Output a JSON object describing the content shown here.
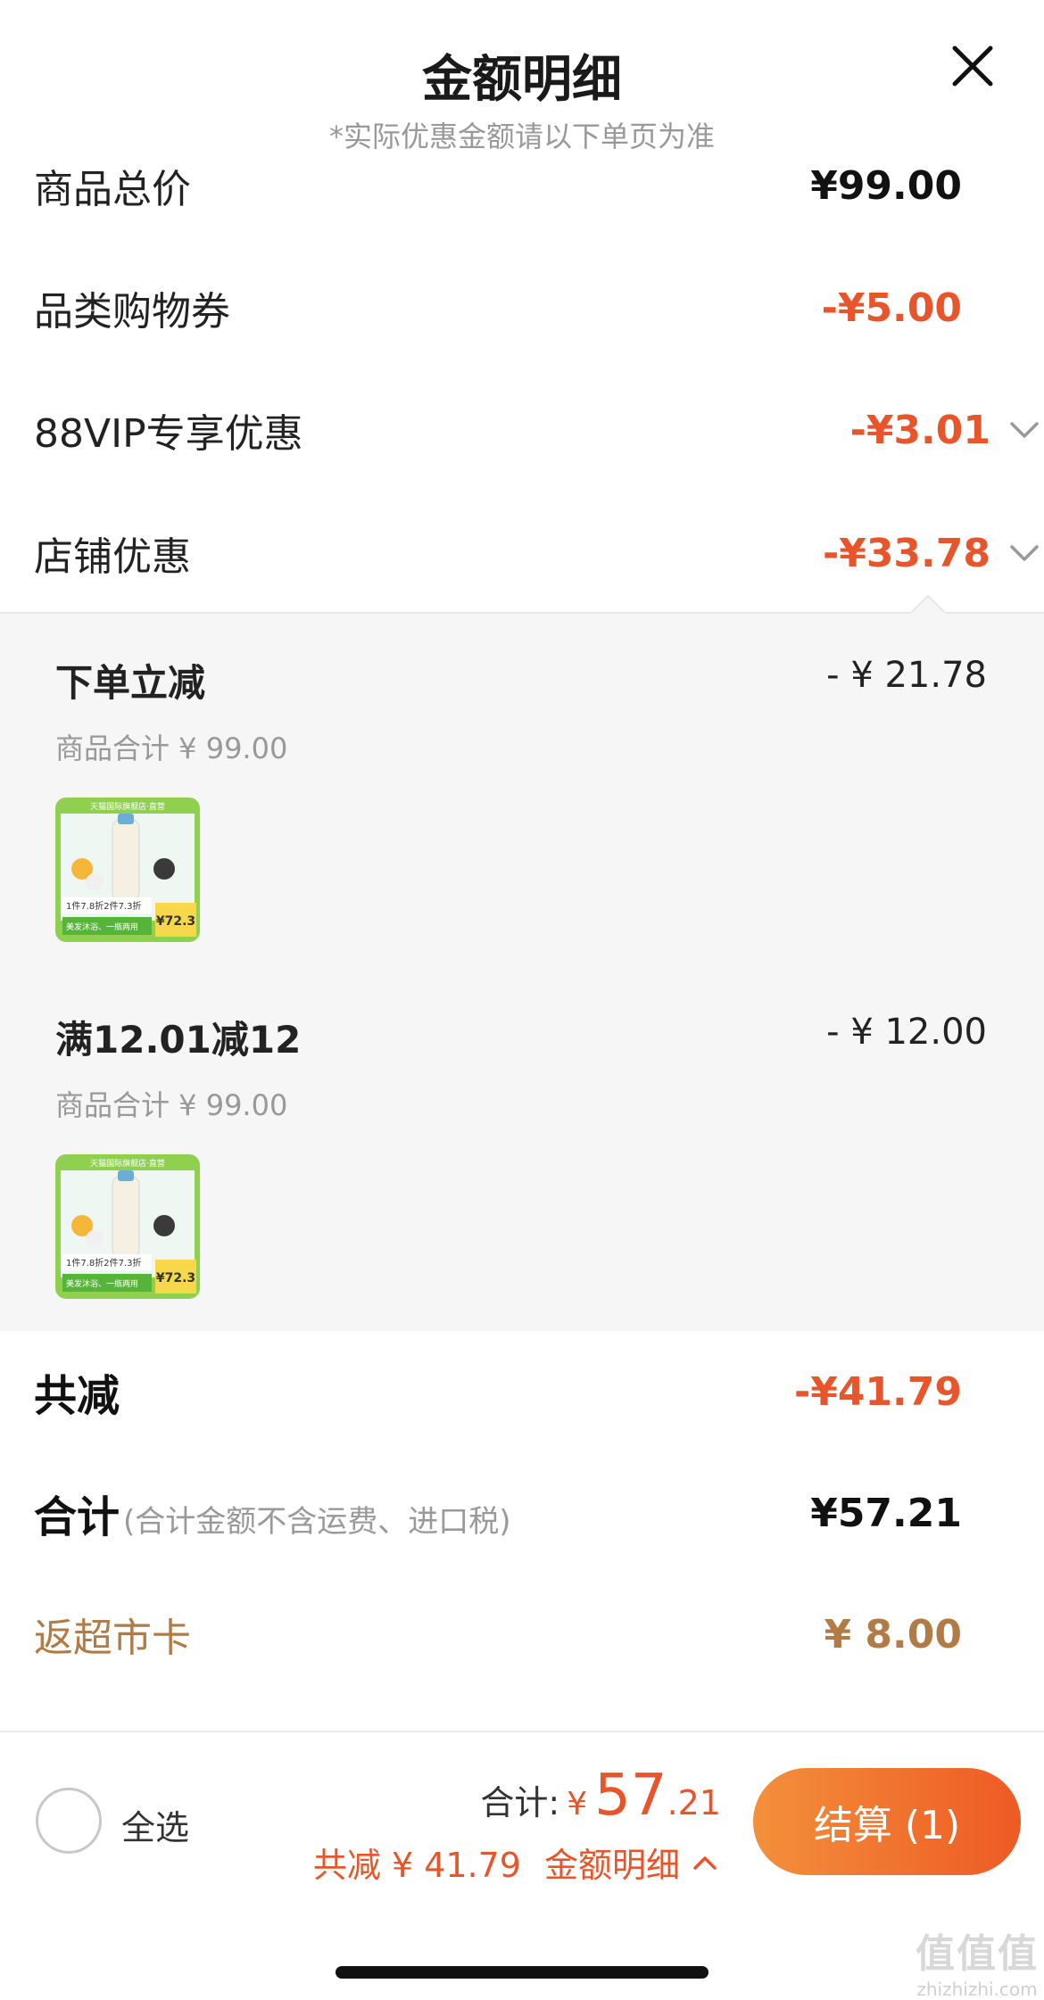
{
  "header": {
    "title": "金额明细",
    "subtitle": "*实际优惠金额请以下单页为准",
    "close_icon": "close-icon"
  },
  "rows": [
    {
      "label": "商品总价",
      "value": "¥99.00",
      "color": "#111111"
    },
    {
      "label": "品类购物券",
      "value": "-¥5.00",
      "color": "#e8552a"
    },
    {
      "label": "88VIP专享优惠",
      "value": "-¥3.01",
      "color": "#e8552a",
      "expandable": true
    },
    {
      "label": "店铺优惠",
      "value": "-¥33.78",
      "color": "#e8552a",
      "expandable": true,
      "expanded": true
    }
  ],
  "store_discounts": [
    {
      "title": "下单立减",
      "amount": "- ¥ 21.78",
      "subtotal": "商品合计 ¥ 99.00",
      "thumb": {
        "top_text": "天猫国际旗舰店·直营",
        "line1": "1件7.8折2件7.3折",
        "line2": "美发沐浴、一瓶两用",
        "price": "¥72.3"
      }
    },
    {
      "title": "满12.01减12",
      "amount": "- ¥ 12.00",
      "subtotal": "商品合计 ¥ 99.00",
      "thumb": {
        "top_text": "天猫国际旗舰店·直营",
        "line1": "1件7.8折2件7.3折",
        "line2": "美发沐浴、一瓶两用",
        "price": "¥72.3"
      }
    }
  ],
  "totals": {
    "discount_label": "共减",
    "discount_value": "-¥41.79",
    "sum_label": "合计",
    "sum_note": "(合计金额不含运费、进口税)",
    "sum_value": "¥57.21",
    "cashback_label": "返超市卡",
    "cashback_value": "¥ 8.00"
  },
  "footer": {
    "select_all": "全选",
    "sum_label": "合计:",
    "yen": "¥",
    "price_int": "57",
    "price_dec": ".21",
    "saving": "共减 ¥ 41.79",
    "detail_link": "金额明细",
    "checkout": "结算 (1)"
  },
  "watermark": {
    "logo": "值值值",
    "text": "zhizhizhi.com"
  },
  "colors": {
    "accent": "#e8552a",
    "gold": "#b07b47",
    "gray": "#999999"
  }
}
